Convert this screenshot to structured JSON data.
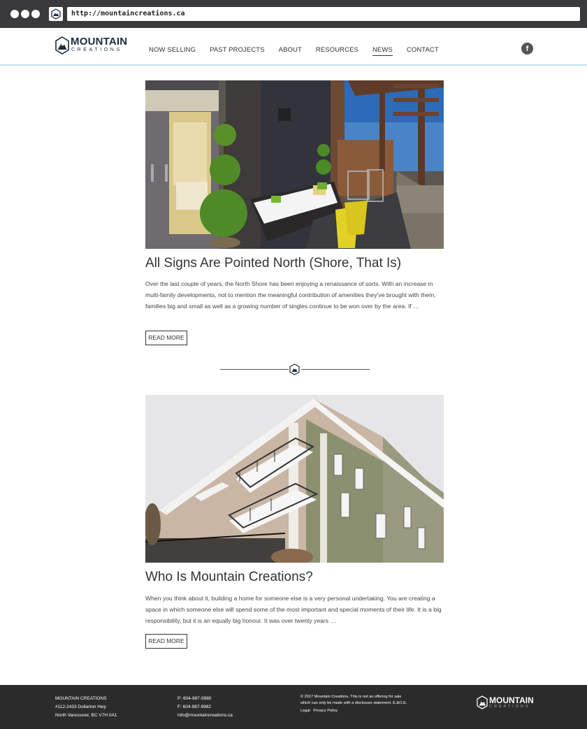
{
  "browser": {
    "url": "http://mountaincreations.ca"
  },
  "brand": {
    "name": "MOUNTAIN",
    "sub": "CREATIONS"
  },
  "nav": [
    "NOW SELLING",
    "PAST PROJECTS",
    "ABOUT",
    "RESOURCES",
    "NEWS",
    "CONTACT"
  ],
  "nav_active": "NEWS",
  "social": {
    "facebook": "f"
  },
  "posts": [
    {
      "title": "All Signs Are Pointed North (Shore, That Is)",
      "excerpt": "Over the last couple of years, the North Shore has been enjoying a renaissance of sorts. With an increase in multi-family developments, not to mention the meaningful contribution of amenities they’ve brought with them, families big and small as well as a growing number of singles continue to be won over by the area. If …",
      "cta": "READ MORE"
    },
    {
      "title": "Who Is Mountain Creations?",
      "excerpt": "When you think about it, building a home for someone else is a very personal undertaking. You are creating a space in which someone else will spend some of the most important and special moments of their life. It is a big responsibility, but it is an equally big honour. It was over twenty years …",
      "cta": "READ MORE"
    }
  ],
  "footer": {
    "company": "MOUNTAIN CREATIONS",
    "address1": "#112-2433 Dollarton Hwy",
    "address2": "North Vancouver, BC V7H 0A1",
    "phone": "P: 604-987-9980",
    "fax": "F: 604-987-9982",
    "email": "info@mountaincreations.ca",
    "disclaimer": "© 2017 Mountain Creations. This is not an offering for sale which can only be made with a disclosure statement. E.&O.E.",
    "legal": "Legal",
    "privacy": "Privacy Policy",
    "logo_title": "MOUNTAIN",
    "logo_sub": "CREATIONS"
  },
  "colors": {
    "chrome": "#3a3a3c",
    "header_border": "#bfe0f2",
    "brand_navy": "#1d2b3d",
    "footer": "#2b2b2b"
  }
}
